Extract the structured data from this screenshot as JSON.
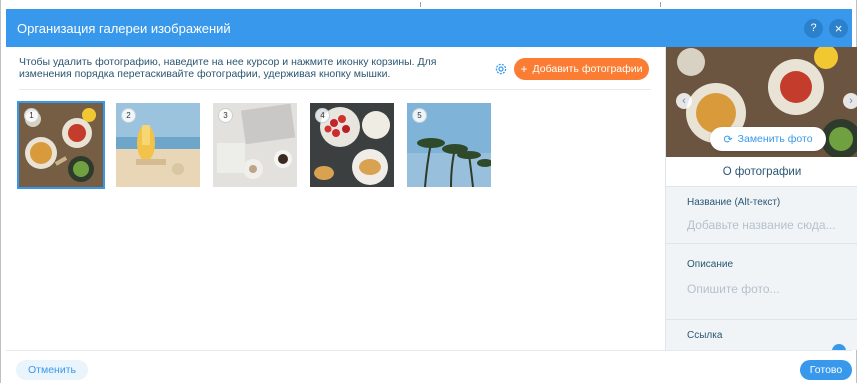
{
  "dialog": {
    "title": "Организация галереи изображений",
    "help_label": "?",
    "close_label": "×"
  },
  "toolbar": {
    "instructions": "Чтобы удалить фотографию, наведите на нее курсор и нажмите иконку корзины. Для изменения порядка перетаскивайте фотографии, удерживая кнопку мышки.",
    "settings_icon": "gear-icon",
    "add_label": "Добавить фотографии",
    "add_icon": "+",
    "accent_color": "#fb7d33"
  },
  "gallery": {
    "selected_index": 1,
    "photos": [
      {
        "number": "1",
        "subject": "food-table"
      },
      {
        "number": "2",
        "subject": "beach-drink"
      },
      {
        "number": "3",
        "subject": "laptop-coffee"
      },
      {
        "number": "4",
        "subject": "strawberries-croissants"
      },
      {
        "number": "5",
        "subject": "palm-trees"
      }
    ]
  },
  "side_panel": {
    "replace_label": "Заменить фото",
    "replace_icon": "refresh-icon",
    "prev_icon": "‹",
    "next_icon": "›",
    "about_title": "О фотографии",
    "alt_label": "Название (Alt-текст)",
    "alt_placeholder": "Добавьте название сюда...",
    "description_label": "Описание",
    "description_placeholder": "Опишите фото...",
    "link_label": "Ссылка"
  },
  "footer": {
    "cancel_label": "Отменить",
    "done_label": "Готово"
  },
  "colors": {
    "header": "#3899ec",
    "primary": "#3899ec",
    "panel": "#f0f4f7"
  }
}
